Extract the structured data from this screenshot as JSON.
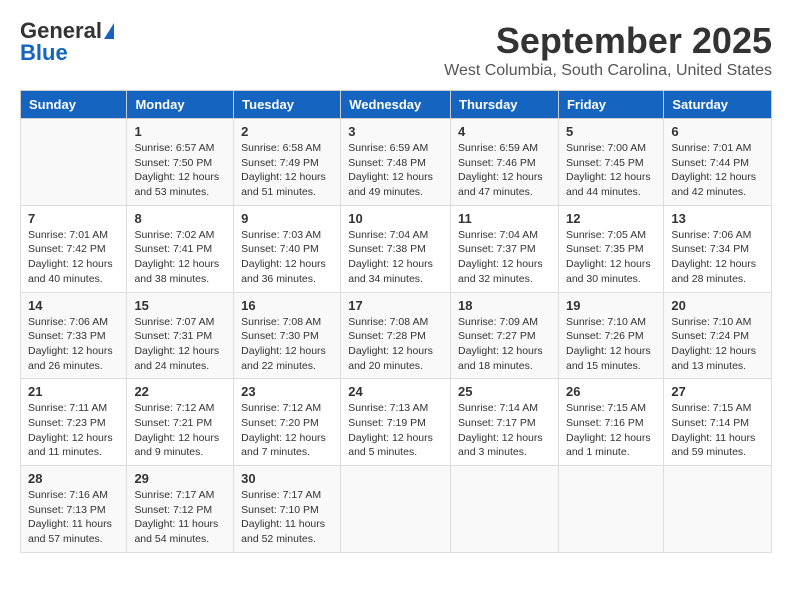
{
  "header": {
    "logo_general": "General",
    "logo_blue": "Blue",
    "month": "September 2025",
    "location": "West Columbia, South Carolina, United States"
  },
  "weekdays": [
    "Sunday",
    "Monday",
    "Tuesday",
    "Wednesday",
    "Thursday",
    "Friday",
    "Saturday"
  ],
  "weeks": [
    [
      {
        "day": "",
        "info": ""
      },
      {
        "day": "1",
        "info": "Sunrise: 6:57 AM\nSunset: 7:50 PM\nDaylight: 12 hours\nand 53 minutes."
      },
      {
        "day": "2",
        "info": "Sunrise: 6:58 AM\nSunset: 7:49 PM\nDaylight: 12 hours\nand 51 minutes."
      },
      {
        "day": "3",
        "info": "Sunrise: 6:59 AM\nSunset: 7:48 PM\nDaylight: 12 hours\nand 49 minutes."
      },
      {
        "day": "4",
        "info": "Sunrise: 6:59 AM\nSunset: 7:46 PM\nDaylight: 12 hours\nand 47 minutes."
      },
      {
        "day": "5",
        "info": "Sunrise: 7:00 AM\nSunset: 7:45 PM\nDaylight: 12 hours\nand 44 minutes."
      },
      {
        "day": "6",
        "info": "Sunrise: 7:01 AM\nSunset: 7:44 PM\nDaylight: 12 hours\nand 42 minutes."
      }
    ],
    [
      {
        "day": "7",
        "info": "Sunrise: 7:01 AM\nSunset: 7:42 PM\nDaylight: 12 hours\nand 40 minutes."
      },
      {
        "day": "8",
        "info": "Sunrise: 7:02 AM\nSunset: 7:41 PM\nDaylight: 12 hours\nand 38 minutes."
      },
      {
        "day": "9",
        "info": "Sunrise: 7:03 AM\nSunset: 7:40 PM\nDaylight: 12 hours\nand 36 minutes."
      },
      {
        "day": "10",
        "info": "Sunrise: 7:04 AM\nSunset: 7:38 PM\nDaylight: 12 hours\nand 34 minutes."
      },
      {
        "day": "11",
        "info": "Sunrise: 7:04 AM\nSunset: 7:37 PM\nDaylight: 12 hours\nand 32 minutes."
      },
      {
        "day": "12",
        "info": "Sunrise: 7:05 AM\nSunset: 7:35 PM\nDaylight: 12 hours\nand 30 minutes."
      },
      {
        "day": "13",
        "info": "Sunrise: 7:06 AM\nSunset: 7:34 PM\nDaylight: 12 hours\nand 28 minutes."
      }
    ],
    [
      {
        "day": "14",
        "info": "Sunrise: 7:06 AM\nSunset: 7:33 PM\nDaylight: 12 hours\nand 26 minutes."
      },
      {
        "day": "15",
        "info": "Sunrise: 7:07 AM\nSunset: 7:31 PM\nDaylight: 12 hours\nand 24 minutes."
      },
      {
        "day": "16",
        "info": "Sunrise: 7:08 AM\nSunset: 7:30 PM\nDaylight: 12 hours\nand 22 minutes."
      },
      {
        "day": "17",
        "info": "Sunrise: 7:08 AM\nSunset: 7:28 PM\nDaylight: 12 hours\nand 20 minutes."
      },
      {
        "day": "18",
        "info": "Sunrise: 7:09 AM\nSunset: 7:27 PM\nDaylight: 12 hours\nand 18 minutes."
      },
      {
        "day": "19",
        "info": "Sunrise: 7:10 AM\nSunset: 7:26 PM\nDaylight: 12 hours\nand 15 minutes."
      },
      {
        "day": "20",
        "info": "Sunrise: 7:10 AM\nSunset: 7:24 PM\nDaylight: 12 hours\nand 13 minutes."
      }
    ],
    [
      {
        "day": "21",
        "info": "Sunrise: 7:11 AM\nSunset: 7:23 PM\nDaylight: 12 hours\nand 11 minutes."
      },
      {
        "day": "22",
        "info": "Sunrise: 7:12 AM\nSunset: 7:21 PM\nDaylight: 12 hours\nand 9 minutes."
      },
      {
        "day": "23",
        "info": "Sunrise: 7:12 AM\nSunset: 7:20 PM\nDaylight: 12 hours\nand 7 minutes."
      },
      {
        "day": "24",
        "info": "Sunrise: 7:13 AM\nSunset: 7:19 PM\nDaylight: 12 hours\nand 5 minutes."
      },
      {
        "day": "25",
        "info": "Sunrise: 7:14 AM\nSunset: 7:17 PM\nDaylight: 12 hours\nand 3 minutes."
      },
      {
        "day": "26",
        "info": "Sunrise: 7:15 AM\nSunset: 7:16 PM\nDaylight: 12 hours\nand 1 minute."
      },
      {
        "day": "27",
        "info": "Sunrise: 7:15 AM\nSunset: 7:14 PM\nDaylight: 11 hours\nand 59 minutes."
      }
    ],
    [
      {
        "day": "28",
        "info": "Sunrise: 7:16 AM\nSunset: 7:13 PM\nDaylight: 11 hours\nand 57 minutes."
      },
      {
        "day": "29",
        "info": "Sunrise: 7:17 AM\nSunset: 7:12 PM\nDaylight: 11 hours\nand 54 minutes."
      },
      {
        "day": "30",
        "info": "Sunrise: 7:17 AM\nSunset: 7:10 PM\nDaylight: 11 hours\nand 52 minutes."
      },
      {
        "day": "",
        "info": ""
      },
      {
        "day": "",
        "info": ""
      },
      {
        "day": "",
        "info": ""
      },
      {
        "day": "",
        "info": ""
      }
    ]
  ]
}
